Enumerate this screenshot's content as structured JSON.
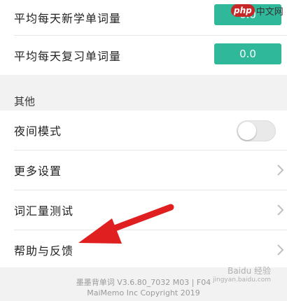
{
  "settings": {
    "new_words_label": "平均每天新学单词量",
    "new_words_value": "0.0",
    "review_words_label": "平均每天复习单词量",
    "review_words_value": "0.0"
  },
  "section_other": {
    "title": "其他",
    "items": [
      {
        "label": "夜间模式"
      },
      {
        "label": "更多设置"
      },
      {
        "label": "词汇量测试"
      },
      {
        "label": "帮助与反馈"
      }
    ],
    "night_mode_on": false
  },
  "footer": {
    "line1": "墨墨背单词 V3.6.80_7032 M03 | F04",
    "line2": "MaiMemo Inc Copyright 2019"
  },
  "watermarks": {
    "php_badge": "php",
    "php_cn": "中文网",
    "baidu": "Baidu 经验",
    "baidu_url": "jingyan.baidu.com"
  },
  "colors": {
    "accent": "#2fb89a",
    "arrow": "#e02020",
    "background": "#f2f2f2"
  },
  "icons": {
    "chevron": "chevron-right-icon",
    "arrow": "red-pointer-arrow"
  }
}
